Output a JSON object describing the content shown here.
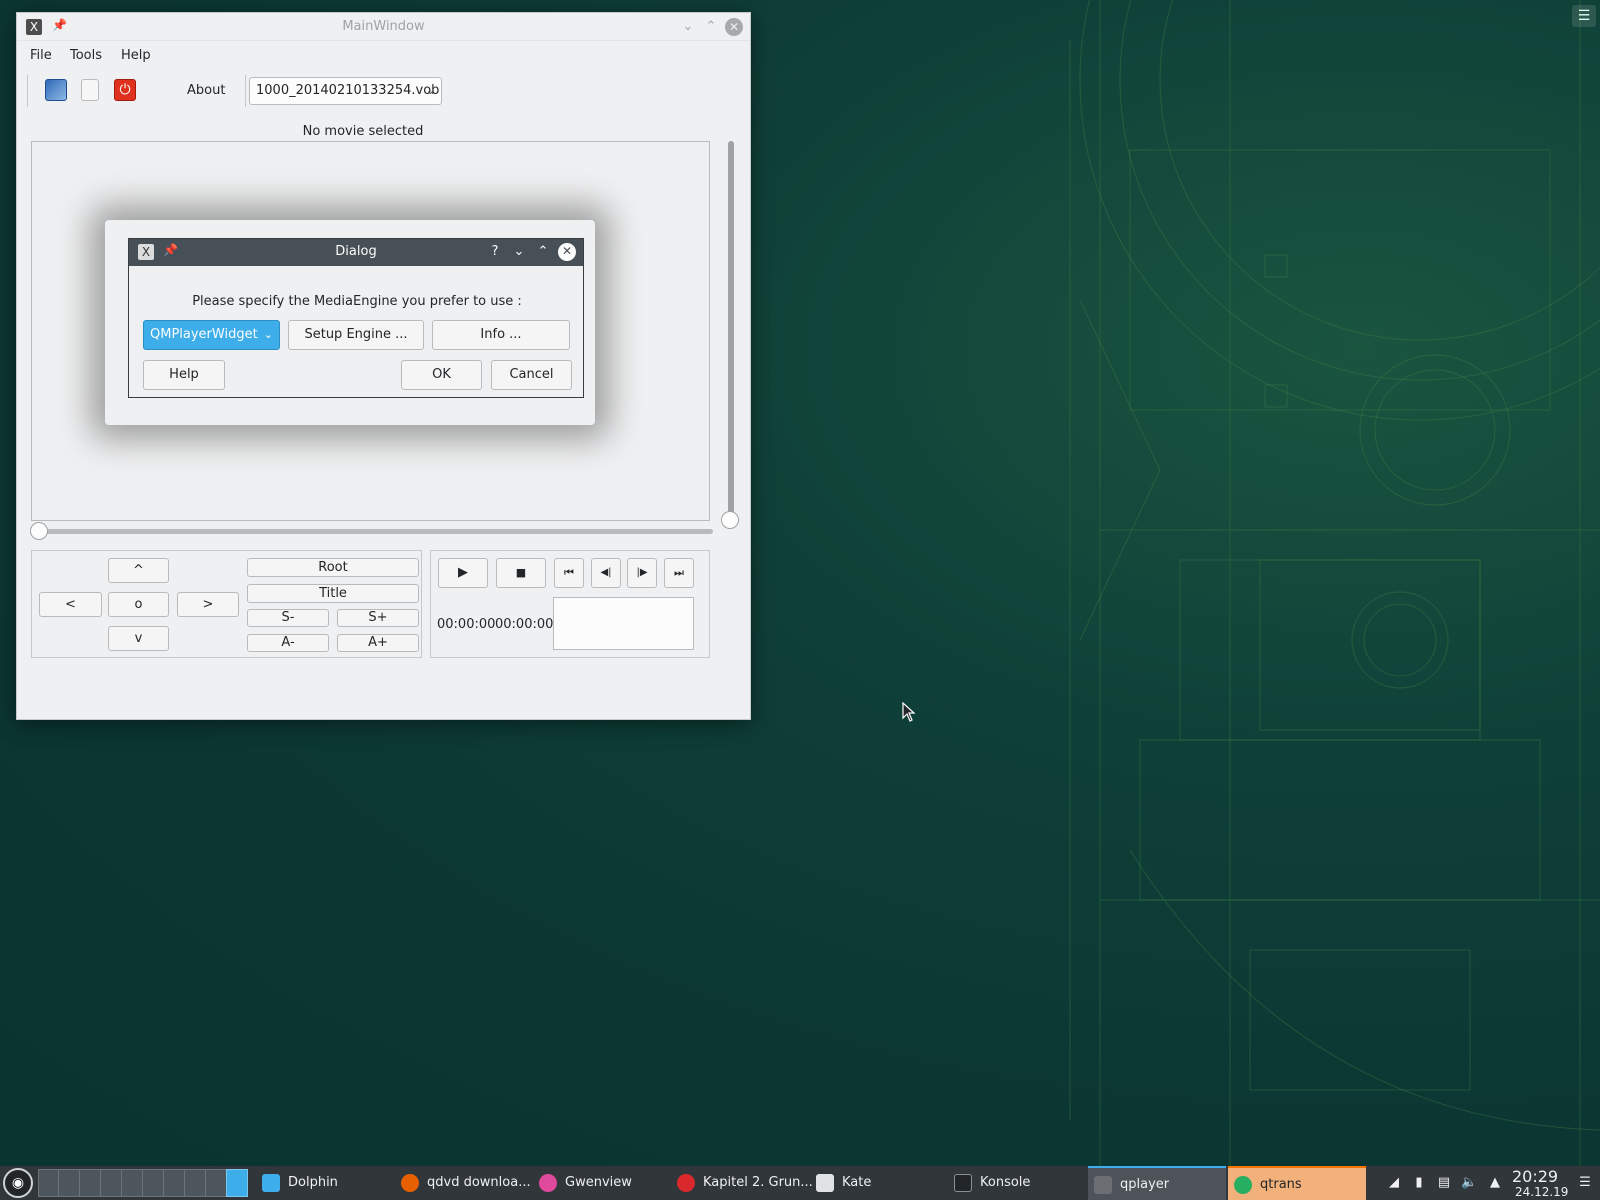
{
  "desktop": {
    "menu_glyph": "☰"
  },
  "main_window": {
    "title": "MainWindow",
    "menu": [
      "File",
      "Tools",
      "Help"
    ],
    "toolbar": {
      "about_label": "About",
      "file_combo_value": "1000_20140210133254.vob"
    },
    "status": "No movie selected",
    "nav": {
      "up": "^",
      "left": "<",
      "ok": "o",
      "right": ">",
      "down": "v",
      "root": "Root",
      "title": "Title",
      "sub_minus": "S-",
      "sub_plus": "S+",
      "audio_minus": "A-",
      "audio_plus": "A+"
    },
    "transport": {
      "play": "▶",
      "stop": "■",
      "first": "⏮",
      "prev": "◀|",
      "next": "|▶",
      "last": "⏭",
      "time_current": "00:00:00",
      "time_total": "00:00:00"
    }
  },
  "dialog": {
    "title": "Dialog",
    "help_glyph": "?",
    "prompt": "Please specify the MediaEngine you prefer to use :",
    "engine_value": "QMPlayerWidget",
    "setup_label": "Setup Engine ...",
    "info_label": "Info ...",
    "help_label": "Help",
    "ok_label": "OK",
    "cancel_label": "Cancel"
  },
  "taskbar": {
    "tasks": [
      {
        "label": "Dolphin",
        "icon_color": "#3daee9"
      },
      {
        "label": "qdvd downloa...",
        "icon_color": "#e66000"
      },
      {
        "label": "Gwenview",
        "icon_color": "#e04a9d"
      },
      {
        "label": "Kapitel 2. Grun...",
        "icon_color": "#d9292d"
      },
      {
        "label": "Kate",
        "icon_color": "#dfe3e6"
      },
      {
        "label": "Konsole",
        "icon_color": "#232629"
      },
      {
        "label": "qplayer",
        "icon_color": "#4d4d4d"
      },
      {
        "label": "qtrans",
        "icon_color": "#27ae60"
      }
    ],
    "clock_time": "20:29",
    "clock_date": "24.12.19"
  },
  "colors": {
    "accent": "#3daee9",
    "window_bg": "#eff0f1",
    "dialog_titlebar": "#475057",
    "taskbar_bg": "#31363b",
    "attention": "#f67400"
  }
}
